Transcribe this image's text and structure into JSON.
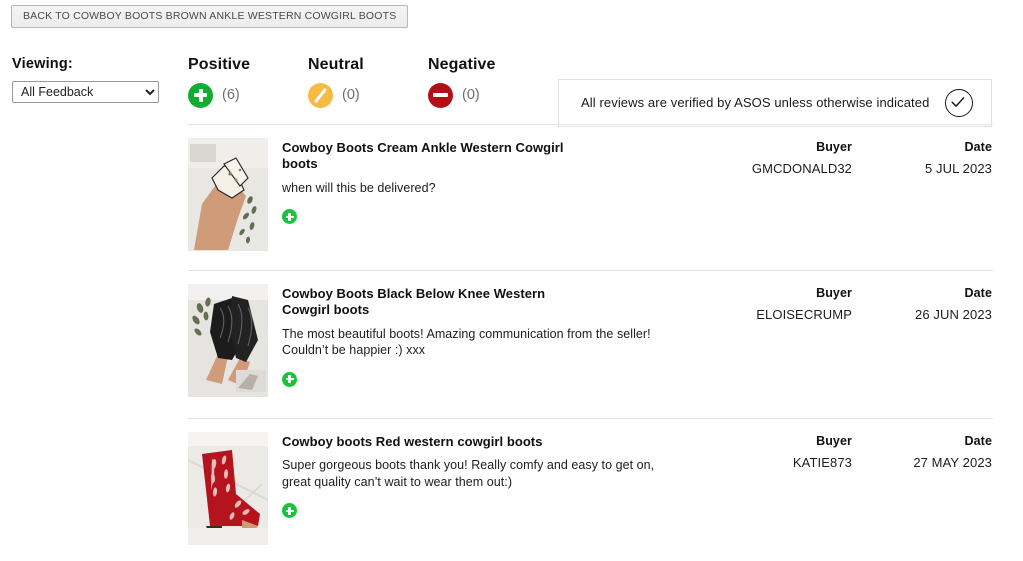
{
  "back_button": {
    "label": "BACK TO COWBOY BOOTS BROWN ANKLE WESTERN COWGIRL BOOTS"
  },
  "filter": {
    "label": "Viewing:",
    "selected": "All Feedback",
    "options": [
      "All Feedback",
      "Positive",
      "Neutral",
      "Negative"
    ]
  },
  "summary": {
    "positive": {
      "title": "Positive",
      "count": "(6)",
      "icon": "plus-circle-icon",
      "color": "#13ac33"
    },
    "neutral": {
      "title": "Neutral",
      "count": "(0)",
      "icon": "slash-circle-icon",
      "color": "#f5bb45"
    },
    "negative": {
      "title": "Negative",
      "count": "(0)",
      "icon": "minus-circle-icon",
      "color": "#b30f17"
    }
  },
  "verified_banner": {
    "text": "All reviews are verified by ASOS unless otherwise indicated",
    "icon": "check-circle-icon"
  },
  "table_headers": {
    "buyer": "Buyer",
    "date": "Date"
  },
  "reviews": [
    {
      "title": "Cowboy Boots Cream Ankle Western Cowgirl boots",
      "comment": "when will this be delivered?",
      "buyer": "GMCDONALD32",
      "date": "5 JUL 2023",
      "sentiment": "positive",
      "thumbnail_alt": "cream-ankle-cowgirl-boots-thumbnail"
    },
    {
      "title": "Cowboy Boots Black Below Knee Western Cowgirl boots",
      "comment": "The most beautiful boots! Amazing communication from the seller! Couldn’t be happier :) xxx",
      "buyer": "ELOISECRUMP",
      "date": "26 JUN 2023",
      "sentiment": "positive",
      "thumbnail_alt": "black-below-knee-cowgirl-boots-thumbnail"
    },
    {
      "title": "Cowboy boots Red western cowgirl boots",
      "comment": "Super gorgeous boots thank you! Really comfy and easy to get on, great quality can’t wait to wear them out:)",
      "buyer": "KATIE873",
      "date": "27 MAY 2023",
      "sentiment": "positive",
      "thumbnail_alt": "red-western-cowgirl-boots-thumbnail"
    }
  ]
}
